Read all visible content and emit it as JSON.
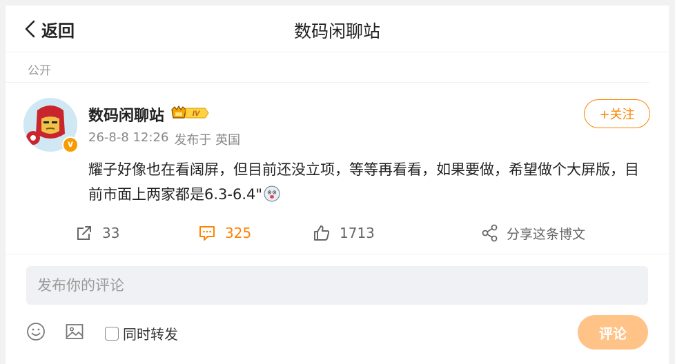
{
  "header": {
    "back_label": "返回",
    "title": "数码闲聊站"
  },
  "post": {
    "visibility": "公开",
    "author": "数码闲聊站",
    "rank_badge": "IV",
    "verified_badge": "v",
    "timestamp": "26-8-8 12:26",
    "source": "发布于 英国",
    "text": "耀子好像也在看阔屏，但目前还没立项，等等再看看，如果要做，希望做个大屏版，目前市面上两家都是6.3-6.4\"",
    "follow_label": "+关注"
  },
  "actions": {
    "repost_count": "33",
    "comment_count": "325",
    "like_count": "1713",
    "share_label": "分享这条博文"
  },
  "composer": {
    "placeholder": "发布你的评论",
    "repost_label": "同时转发",
    "submit_label": "评论"
  },
  "icons": {
    "back": "chevron-left-icon",
    "repost": "repost-icon",
    "comment": "comment-icon",
    "like": "thumbs-up-icon",
    "share": "share-icon",
    "emoji": "smiley-icon",
    "image": "image-icon"
  },
  "colors": {
    "accent": "#ff8200",
    "submit_bg": "#ffc388",
    "input_bg": "#f0f1f4"
  }
}
